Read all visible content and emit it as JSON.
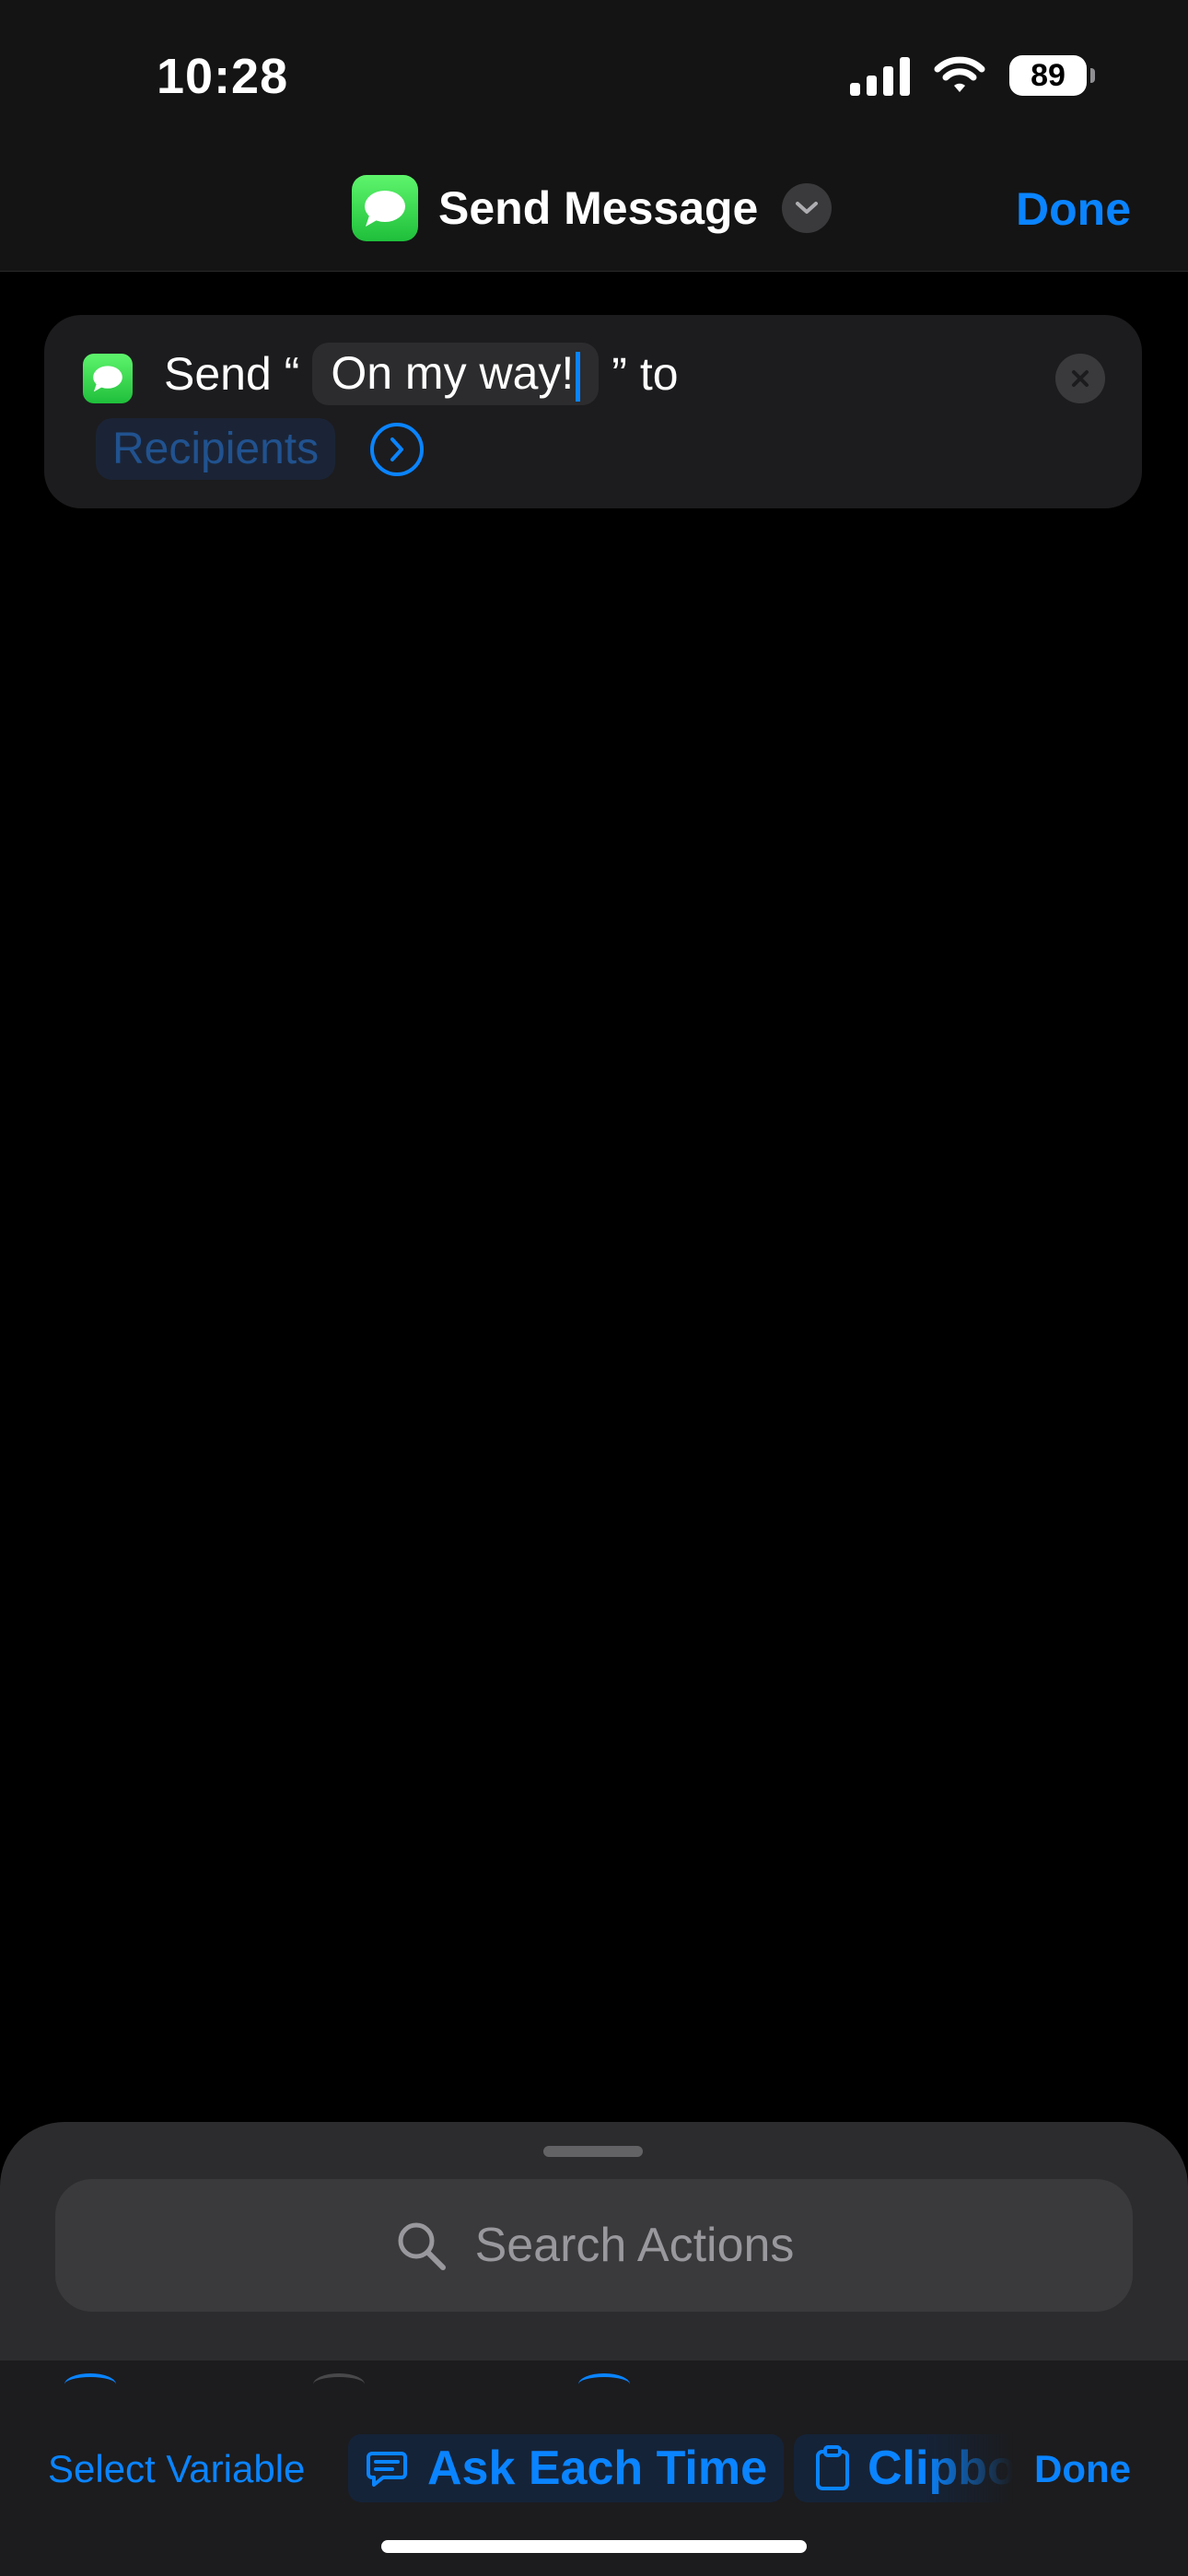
{
  "status_bar": {
    "time": "10:28",
    "battery": "89"
  },
  "nav": {
    "title": "Send Message",
    "done_label": "Done"
  },
  "action": {
    "prefix": "Send “",
    "message": "On my way!",
    "suffix": "” to",
    "recipients_placeholder": "Recipients"
  },
  "search": {
    "placeholder": "Search Actions"
  },
  "toolbar": {
    "select_variable": "Select Variable",
    "ask_each_time": "Ask Each Time",
    "clipboard": "Clipboard",
    "done_label": "Done"
  },
  "colors": {
    "accent": "#0a84ff",
    "messages_green": "#34c759",
    "background": "#000000"
  }
}
